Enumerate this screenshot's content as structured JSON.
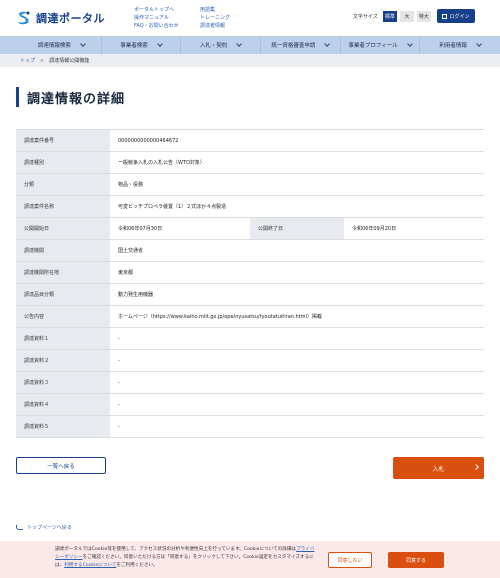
{
  "header": {
    "logo_text": "調達ポータル",
    "links_col1": [
      "ポータルトップへ",
      "操作マニュアル",
      "FAQ・お問い合わせ"
    ],
    "links_col2": [
      "用語集",
      "トレーニング",
      "調達者情報"
    ],
    "font_size_label": "文字サイズ",
    "font_sizes": [
      "標準",
      "大",
      "特大"
    ],
    "login_label": "ログイン"
  },
  "nav": {
    "items": [
      "調達情報検索",
      "事業者検索",
      "入札・契約",
      "統一資格審査申請",
      "事業者プロフィール",
      "利用者情報"
    ]
  },
  "breadcrumb": {
    "home": "トップ",
    "separator": ">",
    "current": "調達情報公開機能"
  },
  "page_title": "調達情報の詳細",
  "details": {
    "case_number_label": "調達案件番号",
    "case_number": "0000000000000464672",
    "type_label": "調達種別",
    "type": "一般競争入札の入札公告（WTO対象）",
    "category_label": "分類",
    "category": "物品・役務",
    "name_label": "調達案件名称",
    "name": "可変ピッチプロペラ装置（1）２式ほか４点製造",
    "start_label": "公開開始日",
    "start": "令和06年07月30日",
    "end_label": "公開終了日",
    "end": "令和06年09月20日",
    "agency_label": "調達機関",
    "agency": "国土交通省",
    "location_label": "調達機関所在地",
    "location": "東京都",
    "item_class_label": "調達品目分類",
    "item_class": "動力発生用機器",
    "notice_label": "公告内容",
    "notice": "ホームページ（https://www.kaiho.mlit.go.jp/ope/nyusatsu/tyoutatuitiran.html）掲載",
    "materials": [
      {
        "label": "調達資料１",
        "value": "-"
      },
      {
        "label": "調達資料２",
        "value": "-"
      },
      {
        "label": "調達資料３",
        "value": "-"
      },
      {
        "label": "調達資料４",
        "value": "-"
      },
      {
        "label": "調達資料５",
        "value": "-"
      }
    ]
  },
  "buttons": {
    "back": "一覧へ戻る",
    "bid": "入札"
  },
  "top_link": "トップページへ戻る",
  "cookie": {
    "text1": "調達ポータルではCookie等を使用して、アクセス状況の分析や利便性向上を行っています。Cookieについての詳細は",
    "privacy_link": "プライバシーポリシー",
    "text2": "をご確認ください。同意いただける方は「同意する」をクリックして下さい。Cookie設定をカスタマイズするには、",
    "usage_link": "利用するCookieについて",
    "text3": "をご利用ください。",
    "deny": "同意しない",
    "agree": "同意する"
  },
  "colors": {
    "brand": "#17408b",
    "nav_bg": "#bcd0ea",
    "accent": "#d94f10",
    "cookie_bg": "#fbe9ea"
  }
}
